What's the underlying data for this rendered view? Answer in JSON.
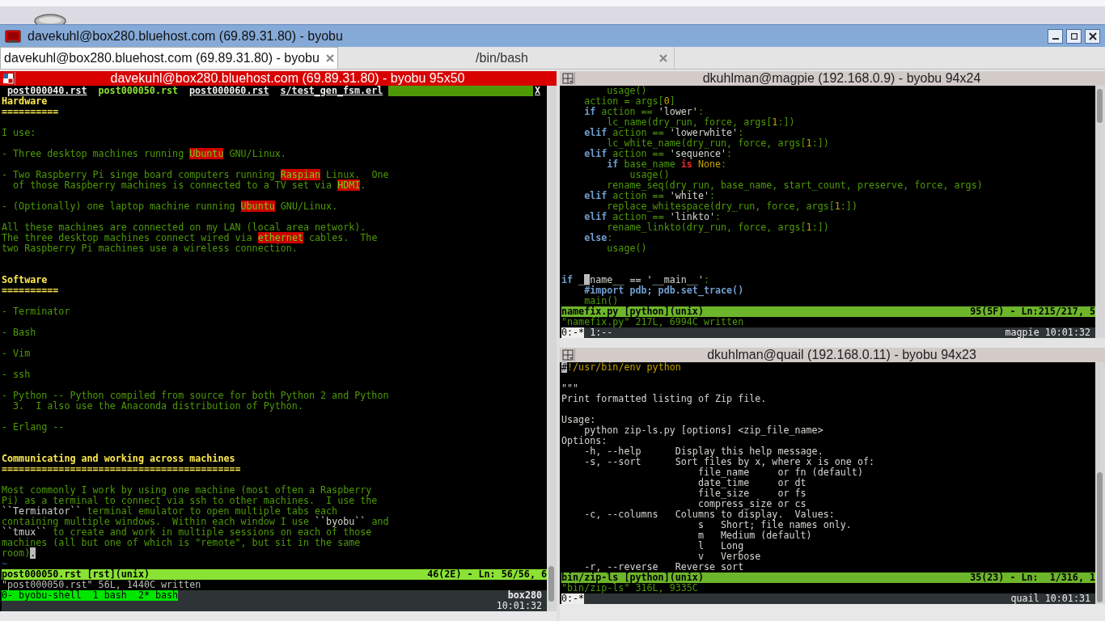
{
  "window": {
    "title": "davekuhl@box280.bluehost.com (69.89.31.80) - byobu"
  },
  "tabs": [
    {
      "label": "davekuhl@box280.bluehost.com (69.89.31.80) - byobu",
      "selected": true
    },
    {
      "label": "/bin/bash",
      "selected": false
    }
  ],
  "panes": [
    {
      "title": "davekuhl@box280.bluehost.com (69.89.31.80) - byobu 95x50",
      "focused": true,
      "vim_tabs": [
        {
          "label": "post000040.rst",
          "selected": false
        },
        {
          "label": "post000050.rst",
          "selected": true
        },
        {
          "label": "post000060.rst",
          "selected": false
        },
        {
          "label": "s/test_gen_fsm.erl",
          "selected": false
        }
      ],
      "tabline_close": "X",
      "lines": [
        {
          "kind": "text",
          "segs": [
            {
              "text": "Hardware",
              "kind": "heading"
            }
          ]
        },
        {
          "kind": "text",
          "segs": [
            {
              "text": "==========",
              "kind": "heading"
            }
          ]
        },
        {
          "kind": "blank"
        },
        {
          "kind": "text",
          "segs": [
            {
              "text": "I use:",
              "kind": "plain"
            }
          ]
        },
        {
          "kind": "blank"
        },
        {
          "kind": "text",
          "segs": [
            {
              "text": "- Three desktop machines running ",
              "kind": "plain"
            },
            {
              "text": "Ubuntu",
              "kind": "mark"
            },
            {
              "text": " GNU/Linux.",
              "kind": "plain"
            }
          ]
        },
        {
          "kind": "blank"
        },
        {
          "kind": "text",
          "segs": [
            {
              "text": "- Two Raspberry Pi singe board computers running ",
              "kind": "plain"
            },
            {
              "text": "Raspian",
              "kind": "mark"
            },
            {
              "text": " Linux.  One",
              "kind": "plain"
            }
          ]
        },
        {
          "kind": "text",
          "segs": [
            {
              "text": "  of those Raspberry machines is connected to a TV set via ",
              "kind": "plain"
            },
            {
              "text": "HDMI",
              "kind": "mark"
            },
            {
              "text": ".",
              "kind": "plain"
            }
          ]
        },
        {
          "kind": "blank"
        },
        {
          "kind": "text",
          "segs": [
            {
              "text": "- (Optionally) one laptop machine running ",
              "kind": "plain"
            },
            {
              "text": "Ubuntu",
              "kind": "mark"
            },
            {
              "text": " GNU/Linux.",
              "kind": "plain"
            }
          ]
        },
        {
          "kind": "blank"
        },
        {
          "kind": "text",
          "segs": [
            {
              "text": "All these machines are connected on my LAN (local area network).",
              "kind": "plain"
            }
          ]
        },
        {
          "kind": "text",
          "segs": [
            {
              "text": "The three desktop machines connect wired via ",
              "kind": "plain"
            },
            {
              "text": "ethernet",
              "kind": "mark"
            },
            {
              "text": " cables.  The",
              "kind": "plain"
            }
          ]
        },
        {
          "kind": "text",
          "segs": [
            {
              "text": "two Raspberry Pi machines use a wireless connection.",
              "kind": "plain"
            }
          ]
        },
        {
          "kind": "blank"
        },
        {
          "kind": "blank"
        },
        {
          "kind": "text",
          "segs": [
            {
              "text": "Software",
              "kind": "heading"
            }
          ]
        },
        {
          "kind": "text",
          "segs": [
            {
              "text": "==========",
              "kind": "heading"
            }
          ]
        },
        {
          "kind": "blank"
        },
        {
          "kind": "text",
          "segs": [
            {
              "text": "- Terminator",
              "kind": "plain"
            }
          ]
        },
        {
          "kind": "blank"
        },
        {
          "kind": "text",
          "segs": [
            {
              "text": "- Bash",
              "kind": "plain"
            }
          ]
        },
        {
          "kind": "blank"
        },
        {
          "kind": "text",
          "segs": [
            {
              "text": "- Vim",
              "kind": "plain"
            }
          ]
        },
        {
          "kind": "blank"
        },
        {
          "kind": "text",
          "segs": [
            {
              "text": "- ssh",
              "kind": "plain"
            }
          ]
        },
        {
          "kind": "blank"
        },
        {
          "kind": "text",
          "segs": [
            {
              "text": "- Python -- Python compiled from source for both Python 2 and Python",
              "kind": "plain"
            }
          ]
        },
        {
          "kind": "text",
          "segs": [
            {
              "text": "  3.  I also use the Anaconda distribution of Python.",
              "kind": "plain"
            }
          ]
        },
        {
          "kind": "blank"
        },
        {
          "kind": "text",
          "segs": [
            {
              "text": "- Erlang --",
              "kind": "plain"
            }
          ]
        },
        {
          "kind": "blank"
        },
        {
          "kind": "blank"
        },
        {
          "kind": "text",
          "segs": [
            {
              "text": "Communicating and working across machines",
              "kind": "heading"
            }
          ]
        },
        {
          "kind": "text",
          "segs": [
            {
              "text": "==========================================",
              "kind": "heading"
            }
          ]
        },
        {
          "kind": "blank"
        },
        {
          "kind": "text",
          "segs": [
            {
              "text": "Most commonly I work by using one machine (most often a Raspberry",
              "kind": "plain"
            }
          ]
        },
        {
          "kind": "text",
          "segs": [
            {
              "text": "Pi) as a terminal to connect via ssh to other machines.  I use the",
              "kind": "plain"
            }
          ]
        },
        {
          "kind": "text",
          "segs": [
            {
              "text": "``Terminator``",
              "kind": "literal"
            },
            {
              "text": " terminal emulator to open multiple tabs each",
              "kind": "plain"
            }
          ]
        },
        {
          "kind": "text",
          "segs": [
            {
              "text": "containing multiple windows.  Within each window I use ",
              "kind": "plain"
            },
            {
              "text": "``byobu``",
              "kind": "literal"
            },
            {
              "text": " and",
              "kind": "plain"
            }
          ]
        },
        {
          "kind": "text",
          "segs": [
            {
              "text": "``tmux``",
              "kind": "literal"
            },
            {
              "text": " to create and work in multiple sessions on each of those",
              "kind": "plain"
            }
          ]
        },
        {
          "kind": "text",
          "segs": [
            {
              "text": "machines (all but one of which is \"remote\", but sit in the same",
              "kind": "plain"
            }
          ]
        },
        {
          "kind": "text",
          "segs": [
            {
              "text": "room)",
              "kind": "plain"
            },
            {
              "text": ".",
              "kind": "cursor"
            }
          ]
        },
        {
          "kind": "text",
          "segs": [
            {
              "text": "~",
              "kind": "tilde"
            }
          ]
        }
      ],
      "status_file": "post000050.rst [rst](unix)",
      "status_position": "46(2E) - Ln: 56/56, 6",
      "message": "\"post000050.rst\" 56L, 1440C written",
      "byobu": {
        "kind": "two-row",
        "session": "0- byobu-shell  1 bash  2* bash",
        "host": "box280",
        "time": "10:01:32"
      }
    },
    {
      "title": "dkuhlman@magpie (192.168.0.9) - byobu 94x24",
      "focused": false,
      "lines": [
        {
          "kind": "text",
          "segs": [
            {
              "text": "        usage()",
              "kind": "plain"
            }
          ]
        },
        {
          "kind": "text",
          "segs": [
            {
              "text": "    action = args[",
              "kind": "plain"
            },
            {
              "text": "0",
              "kind": "number"
            },
            {
              "text": "]",
              "kind": "plain"
            }
          ]
        },
        {
          "kind": "text",
          "segs": [
            {
              "text": "    if",
              "kind": "keyword"
            },
            {
              "text": " action == ",
              "kind": "plain"
            },
            {
              "text": "'lower'",
              "kind": "string"
            },
            {
              "text": ":",
              "kind": "plain"
            }
          ]
        },
        {
          "kind": "text",
          "segs": [
            {
              "text": "        lc_name(dry_run, force, args[",
              "kind": "plain"
            },
            {
              "text": "1",
              "kind": "number"
            },
            {
              "text": ":])",
              "kind": "plain"
            }
          ]
        },
        {
          "kind": "text",
          "segs": [
            {
              "text": "    elif",
              "kind": "keyword"
            },
            {
              "text": " action == ",
              "kind": "plain"
            },
            {
              "text": "'lowerwhite'",
              "kind": "string"
            },
            {
              "text": ":",
              "kind": "plain"
            }
          ]
        },
        {
          "kind": "text",
          "segs": [
            {
              "text": "        lc_white_name(dry_run, force, args[",
              "kind": "plain"
            },
            {
              "text": "1",
              "kind": "number"
            },
            {
              "text": ":])",
              "kind": "plain"
            }
          ]
        },
        {
          "kind": "text",
          "segs": [
            {
              "text": "    elif",
              "kind": "keyword"
            },
            {
              "text": " action == ",
              "kind": "plain"
            },
            {
              "text": "'sequence'",
              "kind": "string"
            },
            {
              "text": ":",
              "kind": "plain"
            }
          ]
        },
        {
          "kind": "text",
          "segs": [
            {
              "text": "        if",
              "kind": "keyword"
            },
            {
              "text": " base_name ",
              "kind": "plain"
            },
            {
              "text": "is",
              "kind": "operator"
            },
            {
              "text": " None",
              "kind": "constant"
            },
            {
              "text": ":",
              "kind": "plain"
            }
          ]
        },
        {
          "kind": "text",
          "segs": [
            {
              "text": "            usage()",
              "kind": "plain"
            }
          ]
        },
        {
          "kind": "text",
          "segs": [
            {
              "text": "        rename_seq(dry_run, base_name, start_count, preserve, force, args)",
              "kind": "plain"
            }
          ]
        },
        {
          "kind": "text",
          "segs": [
            {
              "text": "    elif",
              "kind": "keyword"
            },
            {
              "text": " action == ",
              "kind": "plain"
            },
            {
              "text": "'white'",
              "kind": "string"
            },
            {
              "text": ":",
              "kind": "plain"
            }
          ]
        },
        {
          "kind": "text",
          "segs": [
            {
              "text": "        replace_whitespace(dry_run, force, args[",
              "kind": "plain"
            },
            {
              "text": "1",
              "kind": "number"
            },
            {
              "text": ":])",
              "kind": "plain"
            }
          ]
        },
        {
          "kind": "text",
          "segs": [
            {
              "text": "    elif",
              "kind": "keyword"
            },
            {
              "text": " action == ",
              "kind": "plain"
            },
            {
              "text": "'linkto'",
              "kind": "string"
            },
            {
              "text": ":",
              "kind": "plain"
            }
          ]
        },
        {
          "kind": "text",
          "segs": [
            {
              "text": "        rename_linkto(dry_run, force, args[",
              "kind": "plain"
            },
            {
              "text": "1",
              "kind": "number"
            },
            {
              "text": ":])",
              "kind": "plain"
            }
          ]
        },
        {
          "kind": "text",
          "segs": [
            {
              "text": "    else",
              "kind": "keyword"
            },
            {
              "text": ":",
              "kind": "plain"
            }
          ]
        },
        {
          "kind": "text",
          "segs": [
            {
              "text": "        usage()",
              "kind": "plain"
            }
          ]
        },
        {
          "kind": "blank"
        },
        {
          "kind": "blank"
        },
        {
          "kind": "text",
          "segs": [
            {
              "text": "if",
              "kind": "keyword"
            },
            {
              "text": " _",
              "kind": "literal"
            },
            {
              "text": "_",
              "kind": "cursor"
            },
            {
              "text": "name__ == '__main__'",
              "kind": "literal"
            },
            {
              "text": ":",
              "kind": "plain"
            }
          ]
        },
        {
          "kind": "text",
          "segs": [
            {
              "text": "    #import pdb; pdb.set_trace()",
              "kind": "comment"
            }
          ]
        },
        {
          "kind": "text",
          "segs": [
            {
              "text": "    main()",
              "kind": "plain"
            }
          ]
        }
      ],
      "status_file": "namefix.py [python](unix)",
      "status_position": "95(5F) - Ln:215/217, 5",
      "message": "\"namefix.py\" 217L, 6994C written",
      "byobu": {
        "kind": "one-row",
        "windows": [
          {
            "label": "0:-*",
            "selected": true
          },
          {
            "label": "1:--",
            "selected": false
          }
        ],
        "host": "magpie",
        "time": "10:01:32"
      }
    },
    {
      "title": "dkuhlman@quail (192.168.0.11) - byobu 94x23",
      "focused": false,
      "lines": [
        {
          "kind": "text",
          "segs": [
            {
              "text": "#",
              "kind": "cursor"
            },
            {
              "text": "!/usr/bin/env python",
              "kind": "shebang"
            }
          ]
        },
        {
          "kind": "blank"
        },
        {
          "kind": "text",
          "segs": [
            {
              "text": "\"\"\"",
              "kind": "literal"
            }
          ]
        },
        {
          "kind": "text",
          "segs": [
            {
              "text": "Print formatted listing of Zip file.",
              "kind": "literal"
            }
          ]
        },
        {
          "kind": "blank"
        },
        {
          "kind": "text",
          "segs": [
            {
              "text": "Usage:",
              "kind": "literal"
            }
          ]
        },
        {
          "kind": "text",
          "segs": [
            {
              "text": "    python zip-ls.py [options] <zip_file_name>",
              "kind": "literal"
            }
          ]
        },
        {
          "kind": "text",
          "segs": [
            {
              "text": "Options:",
              "kind": "literal"
            }
          ]
        },
        {
          "kind": "text",
          "segs": [
            {
              "text": "    -h, --help      Display this help message.",
              "kind": "literal"
            }
          ]
        },
        {
          "kind": "text",
          "segs": [
            {
              "text": "    -s, --sort      Sort files by x, where x is one of:",
              "kind": "literal"
            }
          ]
        },
        {
          "kind": "text",
          "segs": [
            {
              "text": "                        file_name     or fn (default)",
              "kind": "literal"
            }
          ]
        },
        {
          "kind": "text",
          "segs": [
            {
              "text": "                        date_time     or dt",
              "kind": "literal"
            }
          ]
        },
        {
          "kind": "text",
          "segs": [
            {
              "text": "                        file_size     or fs",
              "kind": "literal"
            }
          ]
        },
        {
          "kind": "text",
          "segs": [
            {
              "text": "                        compress_size or cs",
              "kind": "literal"
            }
          ]
        },
        {
          "kind": "text",
          "segs": [
            {
              "text": "    -c, --columns   Columns to display.  Values:",
              "kind": "literal"
            }
          ]
        },
        {
          "kind": "text",
          "segs": [
            {
              "text": "                        s   Short; file names only.",
              "kind": "literal"
            }
          ]
        },
        {
          "kind": "text",
          "segs": [
            {
              "text": "                        m   Medium (default)",
              "kind": "literal"
            }
          ]
        },
        {
          "kind": "text",
          "segs": [
            {
              "text": "                        l   Long",
              "kind": "literal"
            }
          ]
        },
        {
          "kind": "text",
          "segs": [
            {
              "text": "                        v   Verbose",
              "kind": "literal"
            }
          ]
        },
        {
          "kind": "text",
          "segs": [
            {
              "text": "    -r, --reverse   Reverse sort",
              "kind": "literal"
            }
          ]
        }
      ],
      "status_file": "bin/zip-ls [python](unix)",
      "status_position": "35(23) - Ln:  1/316, 1",
      "message": "\"bin/zip-ls\" 316L, 9335C",
      "byobu": {
        "kind": "one-row",
        "windows": [
          {
            "label": "0:-*",
            "selected": true
          }
        ],
        "host": "quail",
        "time": "10:01:31"
      }
    }
  ]
}
